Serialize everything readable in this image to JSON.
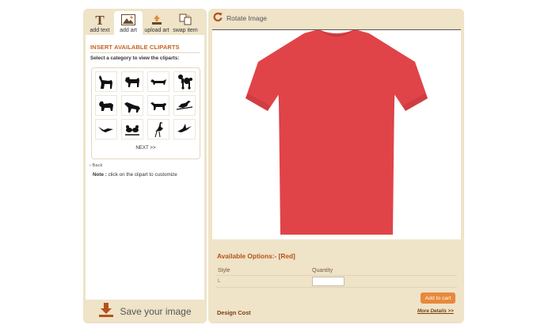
{
  "tabs": [
    {
      "label": "add text",
      "icon": "text-t-icon"
    },
    {
      "label": "add art",
      "icon": "image-icon"
    },
    {
      "label": "upload art",
      "icon": "upload-icon"
    },
    {
      "label": "swap item",
      "icon": "swap-icon"
    }
  ],
  "active_tab": "add art",
  "cliparts": {
    "title": "INSERT AVAILABLE CLIPARTS",
    "subtitle": "Select a category to view the cliparts:",
    "items": [
      {
        "icon": "dog-doberman-icon"
      },
      {
        "icon": "dog-schnauzer-icon"
      },
      {
        "icon": "dog-dachshund-icon"
      },
      {
        "icon": "dog-poodle-icon"
      },
      {
        "icon": "dog-bulldog-icon"
      },
      {
        "icon": "hyena-icon"
      },
      {
        "icon": "wild-dog-icon"
      },
      {
        "icon": "bird-on-branch-icon"
      },
      {
        "icon": "swallow-bird-icon"
      },
      {
        "icon": "birds-pair-icon"
      },
      {
        "icon": "heron-icon"
      },
      {
        "icon": "flying-bird-icon"
      }
    ],
    "next_label": "NEXT >>"
  },
  "back_label": "Back",
  "note": {
    "label": "Note :",
    "text": " click on the clipart to customize"
  },
  "save_label": "Save your image",
  "rotate_label": "Rotate Image",
  "product": {
    "color": "#e04448",
    "image": "red-tshirt"
  },
  "options": {
    "title": "Available Options:- [Red]",
    "style_header": "Style",
    "quantity_header": "Quantity",
    "style_value": "L",
    "quantity_value": ""
  },
  "add_to_cart_label": "Add to cart",
  "design_cost_label": "Design Cost",
  "more_details_label": "More Details >>",
  "colors": {
    "accent": "#c8611f",
    "panel": "#efe3c8",
    "button": "#e9883a"
  }
}
